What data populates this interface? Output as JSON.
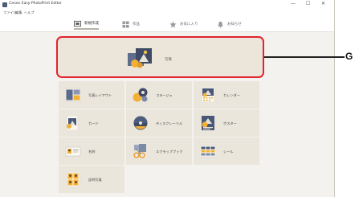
{
  "window": {
    "title": "Canon Easy-PhotoPrint Editor",
    "controls": {
      "minimize": "—",
      "maximize": "☐",
      "close": "✕"
    }
  },
  "menu": {
    "items": [
      "ファイル",
      "編集",
      "ヘルプ"
    ]
  },
  "toolbar": {
    "tabs": [
      {
        "label": "新規作成",
        "icon": "new-icon",
        "active": true
      },
      {
        "label": "作品",
        "icon": "grid-icon",
        "active": false
      },
      {
        "label": "お気に入り",
        "icon": "star-icon",
        "active": false
      },
      {
        "label": "お知らせ",
        "icon": "bell-icon",
        "active": false
      }
    ]
  },
  "featured": {
    "label": "写真",
    "icon": "photo-icon"
  },
  "callout": {
    "label": "G"
  },
  "categories": [
    {
      "label": "写真レイアウト",
      "icon": "photo-layout-icon"
    },
    {
      "label": "コラージュ",
      "icon": "collage-icon"
    },
    {
      "label": "カレンダー",
      "icon": "calendar-icon"
    },
    {
      "label": "カード",
      "icon": "card-icon"
    },
    {
      "label": "ディスクレーベル",
      "icon": "disc-label-icon"
    },
    {
      "label": "ポスター",
      "icon": "poster-icon"
    },
    {
      "label": "名刺",
      "icon": "business-card-icon"
    },
    {
      "label": "スクラップブック",
      "icon": "scrapbook-icon"
    },
    {
      "label": "シール",
      "icon": "sticker-icon"
    },
    {
      "label": "証明写真",
      "icon": "id-photo-icon"
    }
  ]
}
